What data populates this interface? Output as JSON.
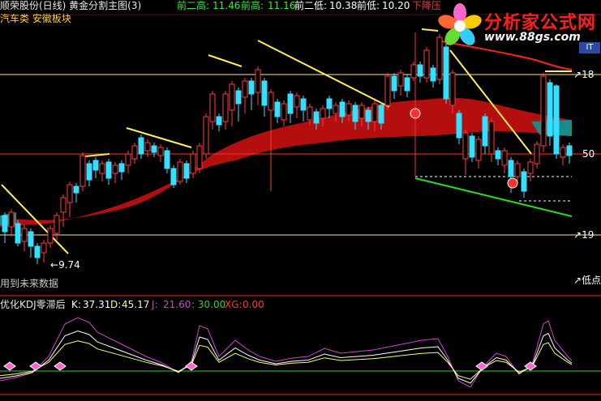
{
  "header": {
    "stock_title": "顺荣股份(日线) 黄金分割主图(3)",
    "stats": [
      {
        "label": "前二高:",
        "value": "11.46"
      },
      {
        "label": "前高:",
        "value": "11.16"
      },
      {
        "label": "前二低:",
        "value": "10.38"
      },
      {
        "label": "前低:",
        "value": "10.20"
      }
    ],
    "trend_label": "下降压",
    "sector_text": "汽车类 安徽板块"
  },
  "watermark": {
    "title": "分析家公式网",
    "url": "www.88gs.com",
    "badge": "IT"
  },
  "main_chart": {
    "price_marks": [
      "18",
      "50",
      "19",
      "9.74"
    ],
    "right_marker": "低点",
    "bottom_note": "用到未来数据",
    "colors": {
      "up": "#ff3b3b",
      "down": "#33e0ff",
      "band": "#b40e0e",
      "yellow_line": "#ffee55",
      "green_line": "#22dd22",
      "red_line": "#ff2020",
      "level_line": "#ffe98a"
    }
  },
  "kdj": {
    "title": "优化KDJ零滞后",
    "k_label": "K:",
    "k_value": "37.31",
    "d_label": "D:",
    "d_value": "45.17",
    "j_label": "J:",
    "j_value": "21.60",
    "ref_value": ": 30.00",
    "xg_label": "XG:",
    "xg_value": "0.00",
    "colors": {
      "k": "#ffffff",
      "d": "#ffff66",
      "j": "#cc44cc",
      "ref": "#33cc33",
      "xg": "#ff3333"
    }
  },
  "chart_data": [
    {
      "type": "candlestick",
      "title": "黄金分割主图(3)",
      "levels": [
        18,
        50,
        19
      ],
      "annotations": [
        "9.74",
        "低点",
        "下降压"
      ]
    },
    {
      "type": "line",
      "title": "优化KDJ零滞后",
      "series": [
        {
          "name": "K",
          "last": 37.31
        },
        {
          "name": "D",
          "last": 45.17
        },
        {
          "name": "J",
          "last": 21.6
        },
        {
          "name": "XG",
          "last": 0.0
        }
      ],
      "reference": 30.0
    }
  ]
}
